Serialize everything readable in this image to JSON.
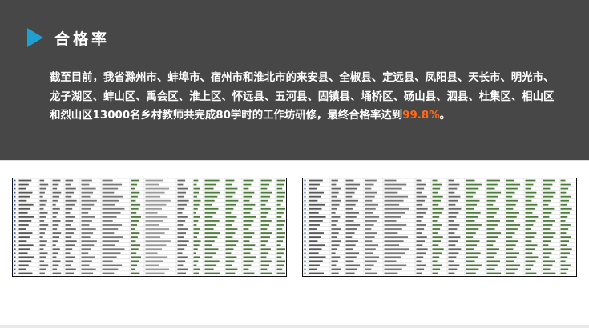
{
  "section": {
    "title": "合格率",
    "icon": "play-triangle-icon",
    "accent_color": "#1ea0d2",
    "background_color": "#474747"
  },
  "summary": {
    "text": "截至目前，我省滁州市、蚌埠市、宿州市和淮北市的来安县、全椒县、定远县、凤阳县、天长市、明光市、龙子湖区、蚌山区、禹会区、淮上区、怀远县、五河县、固镇县、埇桥区、砀山县、泗县、杜集区、相山区和烈山区13000名乡村教师共完成80学时的工作坊研修，最终合格率达到",
    "rate": "99.8%",
    "end": "。",
    "highlight_color": "#ff6a1a"
  },
  "screenshots": [
    {
      "name": "left-roster-sheet",
      "kind": "spreadsheet-thumbnail"
    },
    {
      "name": "right-roster-sheet",
      "kind": "spreadsheet-thumbnail"
    }
  ]
}
